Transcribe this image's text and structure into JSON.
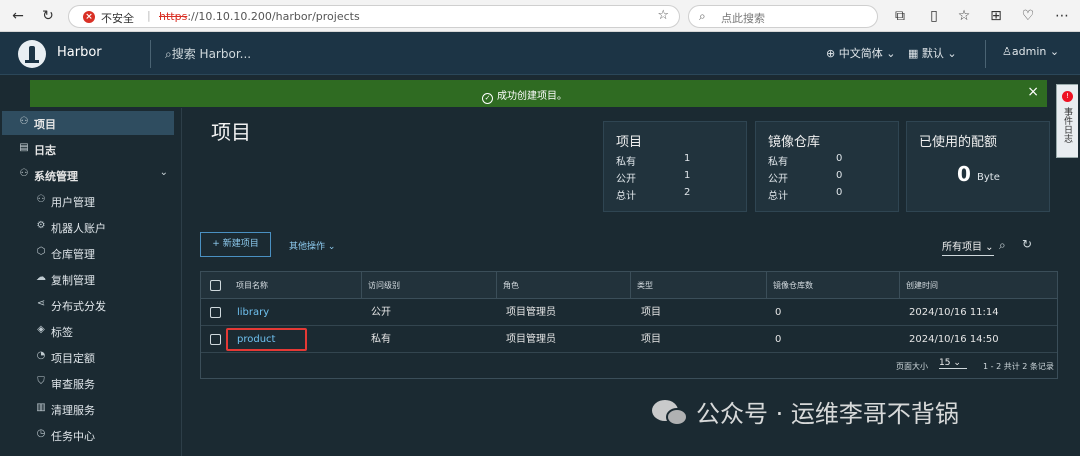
{
  "browser": {
    "insecure_label": "不安全",
    "url_proto": "https",
    "url_rest": "://10.10.10.200/harbor/projects",
    "search_placeholder": "点此搜索"
  },
  "header": {
    "brand": "Harbor",
    "search_placeholder": "搜索 Harbor...",
    "language": "中文简体",
    "theme": "默认",
    "user": "admin"
  },
  "banner": {
    "message": "成功创建项目。"
  },
  "event_tab": {
    "label": "事件日志",
    "badge": "!"
  },
  "sidebar": {
    "items": [
      {
        "label": "项目",
        "icon": "projects-icon"
      },
      {
        "label": "日志",
        "icon": "logs-icon"
      },
      {
        "label": "系统管理",
        "icon": "admin-icon"
      }
    ],
    "admin_sub": [
      {
        "label": "用户管理",
        "icon": "users-icon"
      },
      {
        "label": "机器人账户",
        "icon": "robot-icon"
      },
      {
        "label": "仓库管理",
        "icon": "registry-icon"
      },
      {
        "label": "复制管理",
        "icon": "replication-icon"
      },
      {
        "label": "分布式分发",
        "icon": "distribution-icon"
      },
      {
        "label": "标签",
        "icon": "tag-icon"
      },
      {
        "label": "项目定额",
        "icon": "quota-icon"
      },
      {
        "label": "审查服务",
        "icon": "scanner-icon"
      },
      {
        "label": "清理服务",
        "icon": "clean-icon"
      },
      {
        "label": "任务中心",
        "icon": "job-icon"
      }
    ]
  },
  "main": {
    "title": "项目",
    "cards": {
      "projects": {
        "title": "项目",
        "private_label": "私有",
        "private": "1",
        "public_label": "公开",
        "public": "1",
        "total_label": "总计",
        "total": "2"
      },
      "repos": {
        "title": "镜像仓库",
        "private_label": "私有",
        "private": "0",
        "public_label": "公开",
        "public": "0",
        "total_label": "总计",
        "total": "0"
      },
      "quota": {
        "title": "已使用的配额",
        "value": "0",
        "unit": "Byte"
      }
    },
    "new_project": "+ 新建项目",
    "more_actions": "其他操作",
    "filter": "所有项目",
    "table": {
      "columns": [
        "项目名称",
        "访问级别",
        "角色",
        "类型",
        "镜像仓库数",
        "创建时间"
      ],
      "rows": [
        [
          "library",
          "公开",
          "项目管理员",
          "项目",
          "0",
          "2024/10/16 11:14"
        ],
        [
          "product",
          "私有",
          "项目管理员",
          "项目",
          "0",
          "2024/10/16 14:50"
        ]
      ],
      "page_size_label": "页面大小",
      "page_size": "15",
      "count": "1 - 2 共计 2 条记录"
    }
  },
  "watermark": "公众号 · 运维李哥不背锅"
}
